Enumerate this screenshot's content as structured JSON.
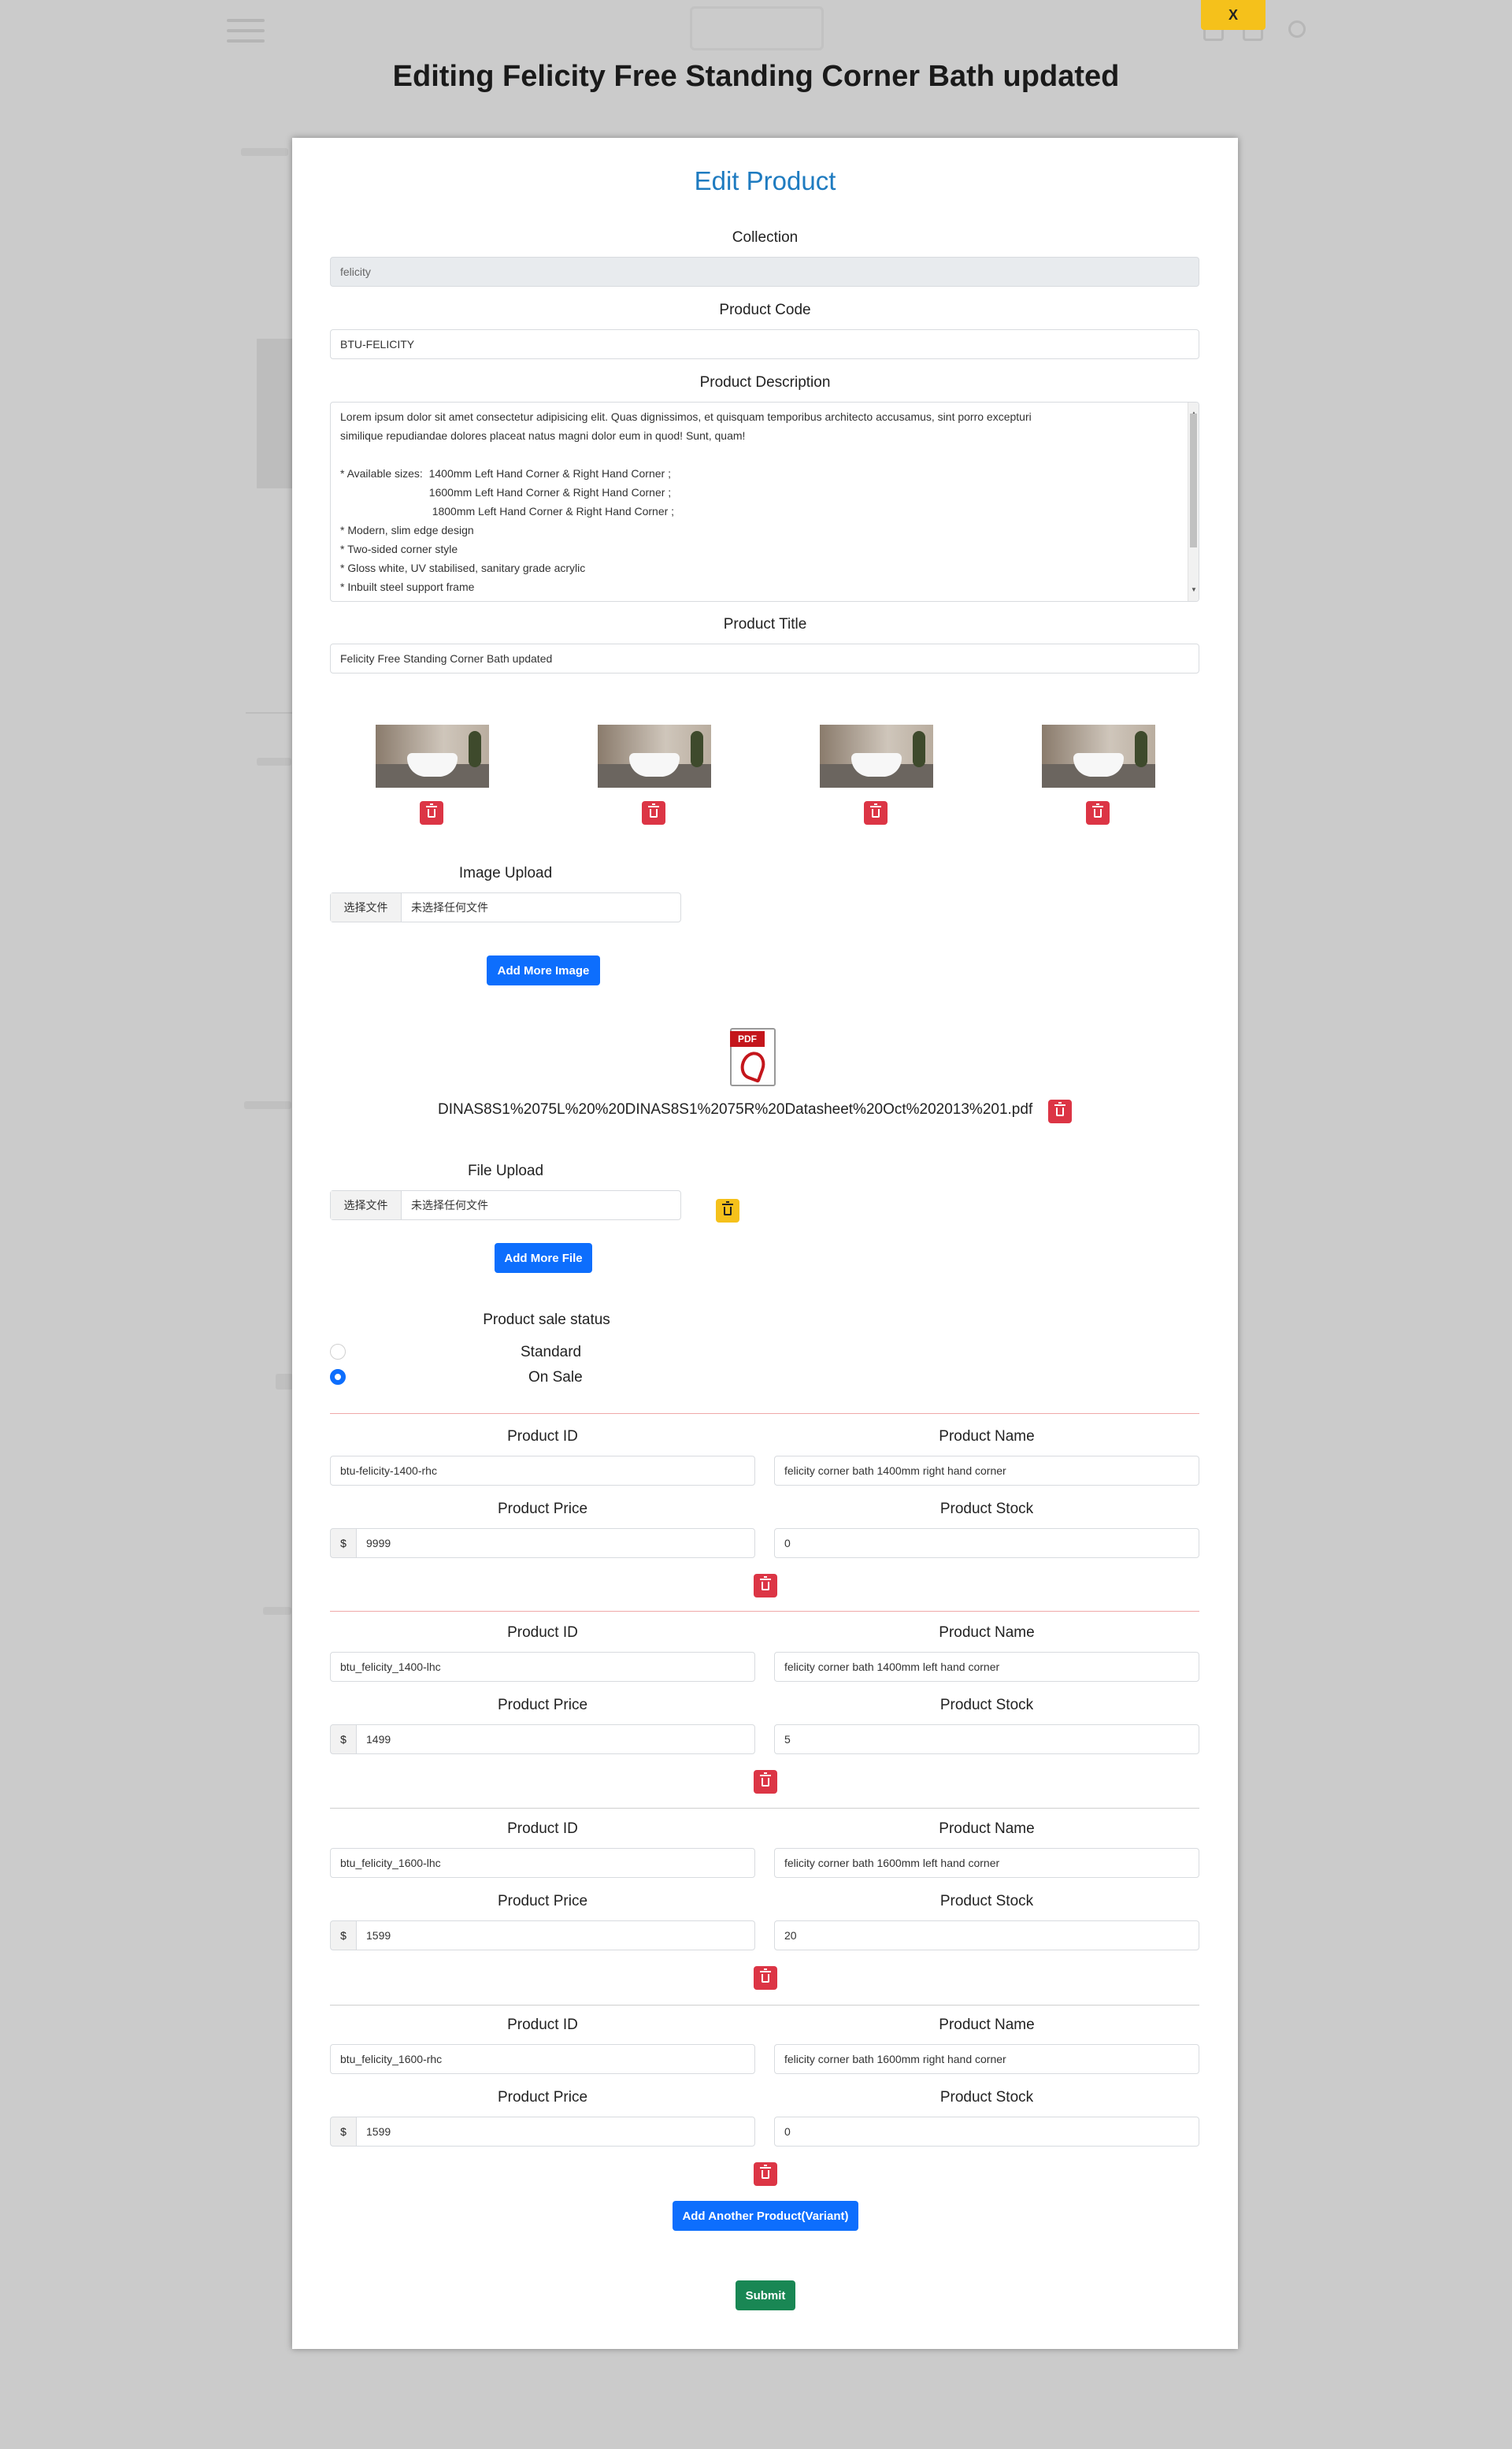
{
  "close_button": "X",
  "page_heading": {
    "prefix": "Editing",
    "product": "Felicity Free Standing Corner Bath updated"
  },
  "modal": {
    "title": "Edit Product",
    "collection": {
      "label": "Collection",
      "value": "felicity"
    },
    "product_code": {
      "label": "Product Code",
      "value": "BTU-FELICITY"
    },
    "description": {
      "label": "Product Description",
      "lines": [
        "Lorem ipsum dolor sit amet consectetur adipisicing elit. Quas dignissimos, et quisquam temporibus architecto accusamus, sint porro excepturi",
        "similique repudiandae dolores placeat natus magni dolor eum in quod! Sunt, quam!",
        "",
        "* Available sizes:  1400mm Left Hand Corner & Right Hand Corner ;",
        "                             1600mm Left Hand Corner & Right Hand Corner ;",
        "                              1800mm Left Hand Corner & Right Hand Corner ;",
        "* Modern, slim edge design",
        "* Two-sided corner style",
        "* Gloss white, UV stabilised, sanitary grade acrylic",
        "* Inbuilt steel support frame"
      ]
    },
    "product_title": {
      "label": "Product Title",
      "value": "Felicity Free Standing Corner Bath updated"
    },
    "images": [
      {
        "alt": "felicity bath image 1"
      },
      {
        "alt": "felicity bath image 2"
      },
      {
        "alt": "felicity bath image 3"
      },
      {
        "alt": "felicity bath image 4"
      }
    ],
    "image_upload": {
      "label": "Image Upload",
      "choose": "选择文件",
      "none": "未选择任何文件"
    },
    "add_more_image": "Add More Image",
    "pdf": {
      "badge": "PDF",
      "filename": "DINAS8S1%2075L%20%20DINAS8S1%2075R%20Datasheet%20Oct%202013%201.pdf"
    },
    "file_upload": {
      "label": "File Upload",
      "choose": "选择文件",
      "none": "未选择任何文件"
    },
    "add_more_file": "Add More File",
    "sale_status": {
      "label": "Product sale status",
      "options": [
        "Standard",
        "On Sale"
      ],
      "selected": "On Sale"
    },
    "variant_labels": {
      "id": "Product ID",
      "name": "Product Name",
      "price": "Product Price",
      "stock": "Product Stock",
      "currency": "$"
    },
    "variants": [
      {
        "id": "btu-felicity-1400-rhc",
        "name": "felicity corner bath 1400mm right hand corner",
        "price": "9999",
        "stock": "0"
      },
      {
        "id": "btu_felicity_1400-lhc",
        "name": "felicity corner bath 1400mm left hand corner",
        "price": "1499",
        "stock": "5"
      },
      {
        "id": "btu_felicity_1600-lhc",
        "name": "felicity corner bath 1600mm left hand corner",
        "price": "1599",
        "stock": "20"
      },
      {
        "id": "btu_felicity_1600-rhc",
        "name": "felicity corner bath 1600mm right hand corner",
        "price": "1599",
        "stock": "0"
      }
    ],
    "add_variant": "Add Another Product(Variant)",
    "submit": "Submit"
  }
}
